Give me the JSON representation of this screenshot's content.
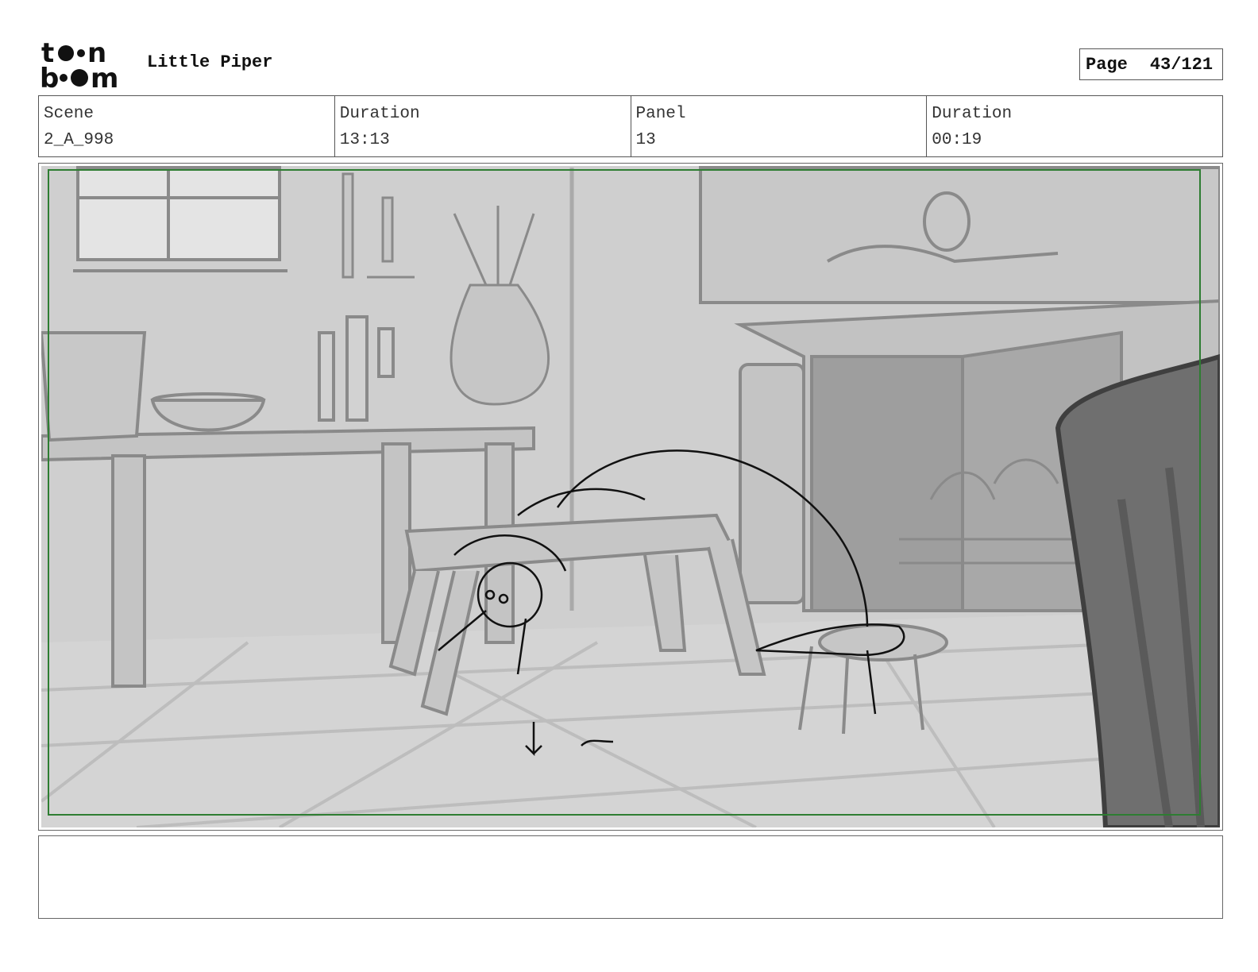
{
  "header": {
    "logo_text": "toon boom",
    "project_title": "Little Piper",
    "page_label": "Page",
    "page_number": "43/121"
  },
  "info": {
    "scene_label": "Scene",
    "scene_value": "2_A_998",
    "scene_duration_label": "Duration",
    "scene_duration_value": "13:13",
    "panel_label": "Panel",
    "panel_value": "13",
    "panel_duration_label": "Duration",
    "panel_duration_value": "00:19"
  },
  "notes": {
    "text": ""
  }
}
